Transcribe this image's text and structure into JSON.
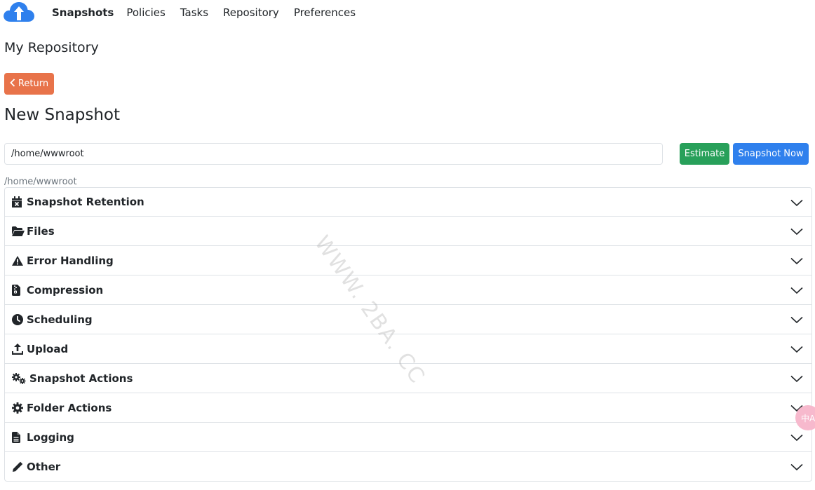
{
  "nav": {
    "logo_icon": "cloud-upload-icon",
    "links": [
      "Snapshots",
      "Policies",
      "Tasks",
      "Repository",
      "Preferences"
    ],
    "active": "Snapshots"
  },
  "page": {
    "repo_title": "My Repository",
    "return_label": "Return",
    "heading": "New Snapshot"
  },
  "path": {
    "value": "/home/wwwroot",
    "hint": "/home/wwwroot",
    "estimate_label": "Estimate",
    "snapshot_now_label": "Snapshot Now"
  },
  "sections": [
    {
      "label": "Snapshot Retention",
      "icon": "calendar-x-icon"
    },
    {
      "label": "Files",
      "icon": "folder-open-icon"
    },
    {
      "label": "Error Handling",
      "icon": "warning-icon"
    },
    {
      "label": "Compression",
      "icon": "file-zipper-icon"
    },
    {
      "label": "Scheduling",
      "icon": "clock-icon"
    },
    {
      "label": "Upload",
      "icon": "upload-icon"
    },
    {
      "label": "Snapshot Actions",
      "icon": "gears-icon"
    },
    {
      "label": "Folder Actions",
      "icon": "gear-icon"
    },
    {
      "label": "Logging",
      "icon": "file-lines-icon"
    },
    {
      "label": "Other",
      "icon": "pencil-icon"
    }
  ],
  "watermark": "WWW. 2BA. CC",
  "float_badge": "中A",
  "colors": {
    "return": "#e8734a",
    "estimate": "#28a05a",
    "snapshot_now": "#2f80ed",
    "logo": "#2f80ed"
  }
}
